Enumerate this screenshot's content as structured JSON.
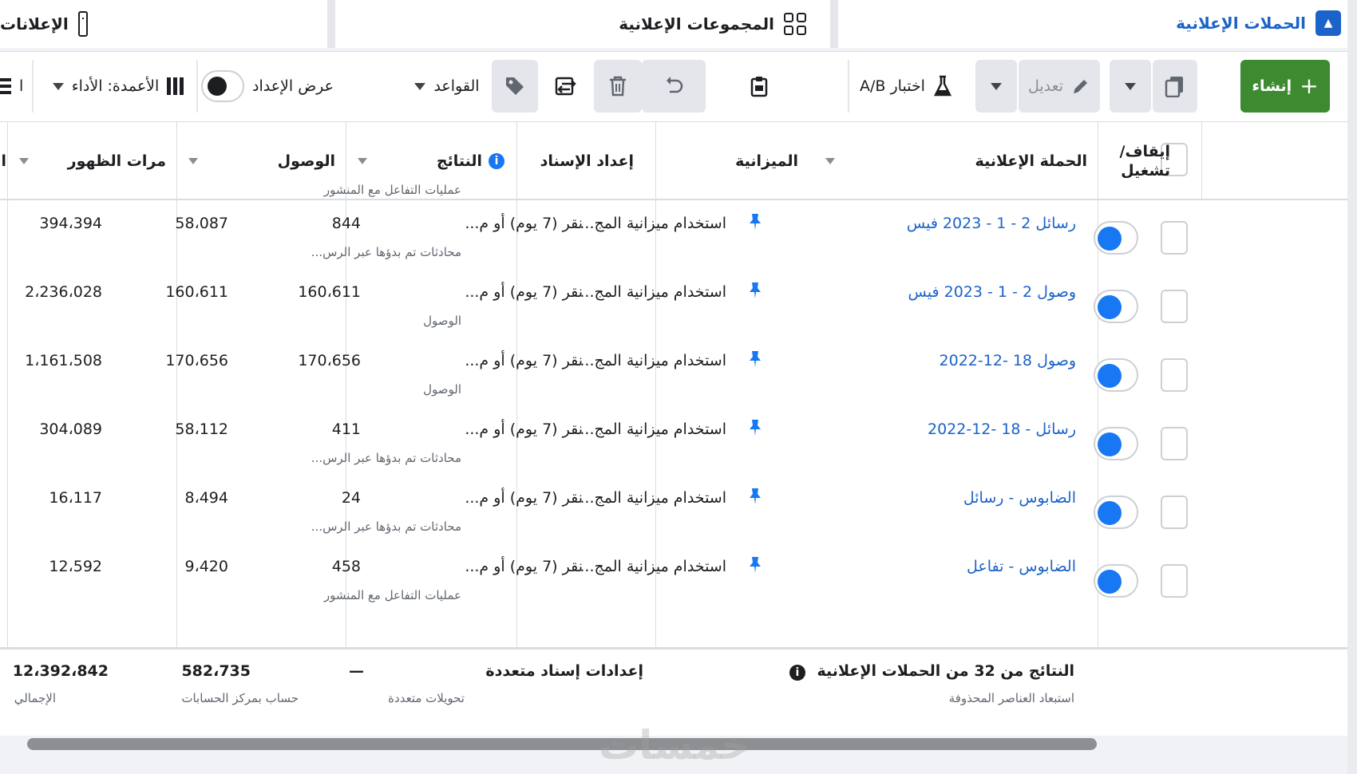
{
  "tabs": {
    "campaigns": "الحملات الإعلانية",
    "adsets": "المجموعات الإعلانية",
    "ads": "الإعلانات"
  },
  "toolbar": {
    "create": "إنشاء",
    "edit": "تعديل",
    "ab_test": "اختبار A/B",
    "rules": "القواعد",
    "view_setup": "عرض الإعداد",
    "columns": "الأعمدة: الأداء",
    "cut_off": "ا"
  },
  "table": {
    "headers": {
      "on_off": "إيقاف/ تشغيل",
      "campaign": "الحملة الإعلانية",
      "budget": "الميزانية",
      "attribution": "إعداد الإسناد",
      "results": "النتائج",
      "reach": "الوصول",
      "impressions": "مرات الظهور",
      "cut_off": "ا"
    },
    "top_partial_sub": "عمليات التفاعل مع المنشور",
    "rows": [
      {
        "campaign": "رسائل 2 - 1 - 2023 فيس",
        "budget": "استخدام ميزانية المج...",
        "attribution": "نقر (7 يوم) أو م...",
        "results": "844",
        "results_sub": "محادثات تم بدؤها عبر الرس...",
        "reach": "58،087",
        "impressions": "394،394"
      },
      {
        "campaign": "وصول 2 - 1 - 2023 فيس",
        "budget": "استخدام ميزانية المج...",
        "attribution": "نقر (7 يوم) أو م...",
        "results": "160،611",
        "results_sub": "الوصول",
        "reach": "160،611",
        "impressions": "2،236،028"
      },
      {
        "campaign": "وصول 18 -12-2022",
        "budget": "استخدام ميزانية المج...",
        "attribution": "نقر (7 يوم) أو م...",
        "results": "170،656",
        "results_sub": "الوصول",
        "reach": "170،656",
        "impressions": "1،161،508"
      },
      {
        "campaign": "رسائل - 18 -12-2022",
        "budget": "استخدام ميزانية المج...",
        "attribution": "نقر (7 يوم) أو م...",
        "results": "411",
        "results_sub": "محادثات تم بدؤها عبر الرس...",
        "reach": "58،112",
        "impressions": "304،089"
      },
      {
        "campaign": "الضابوس - رسائل",
        "budget": "استخدام ميزانية المج...",
        "attribution": "نقر (7 يوم) أو م...",
        "results": "24",
        "results_sub": "محادثات تم بدؤها عبر الرس...",
        "reach": "8،494",
        "impressions": "16،117"
      },
      {
        "campaign": "الضابوس - تفاعل",
        "budget": "استخدام ميزانية المج...",
        "attribution": "نقر (7 يوم) أو م...",
        "results": "458",
        "results_sub": "عمليات التفاعل مع المنشور",
        "reach": "9،420",
        "impressions": "12،592"
      }
    ],
    "footer": {
      "title": "النتائج من 32 من الحملات الإعلانية",
      "subtitle": "استبعاد العناصر المحذوفة",
      "attribution": "إعدادات إسناد متعددة",
      "results": "—",
      "results_sub": "تحويلات متعددة",
      "reach": "582،735",
      "reach_sub": "حساب بمركز الحسابات",
      "impressions": "12،392،842",
      "impressions_sub": "الإجمالي"
    }
  },
  "watermark": "خمسات",
  "colors": {
    "primary_blue": "#1b63c9",
    "toggle_blue": "#1877f2",
    "create_green": "#3d8a30"
  },
  "icons": [
    "campaign-icon",
    "grid-icon",
    "ad-icon",
    "plus-icon",
    "copy-icon",
    "pencil-icon",
    "flask-icon",
    "clipboard-icon",
    "undo-icon",
    "trash-icon",
    "swap-icon",
    "tag-icon",
    "columns-icon",
    "breakdown-icon",
    "pin-icon",
    "info-icon"
  ]
}
